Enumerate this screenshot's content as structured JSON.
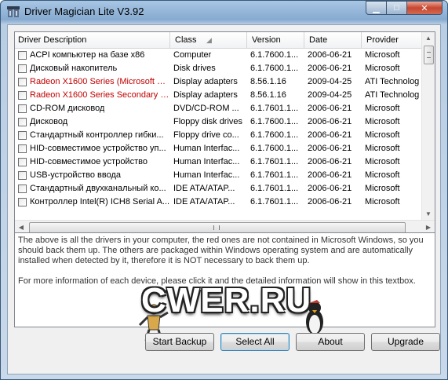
{
  "window": {
    "title": "Driver Magician Lite V3.92"
  },
  "caption_buttons": {
    "minimize": "▁",
    "maximize": "□",
    "close": "✕"
  },
  "columns": [
    "Driver Description",
    "Class",
    "Version",
    "Date",
    "Provider"
  ],
  "rows": [
    {
      "name": "ACPI компьютер на базе x86",
      "class": "Computer",
      "version": "6.1.7600.1...",
      "date": "2006-06-21",
      "provider": "Microsoft",
      "red": false
    },
    {
      "name": "Дисковый накопитель",
      "class": "Disk drives",
      "version": "6.1.7600.1...",
      "date": "2006-06-21",
      "provider": "Microsoft",
      "red": false
    },
    {
      "name": "Radeon X1600 Series (Microsoft C...",
      "class": "Display adapters",
      "version": "8.56.1.16",
      "date": "2009-04-25",
      "provider": "ATI Technolog",
      "red": true
    },
    {
      "name": "Radeon X1600 Series Secondary (...",
      "class": "Display adapters",
      "version": "8.56.1.16",
      "date": "2009-04-25",
      "provider": "ATI Technolog",
      "red": true
    },
    {
      "name": "CD-ROM дисковод",
      "class": "DVD/CD-ROM ...",
      "version": "6.1.7601.1...",
      "date": "2006-06-21",
      "provider": "Microsoft",
      "red": false
    },
    {
      "name": "Дисковод",
      "class": "Floppy disk drives",
      "version": "6.1.7600.1...",
      "date": "2006-06-21",
      "provider": "Microsoft",
      "red": false
    },
    {
      "name": "Стандартный контроллер гибки...",
      "class": "Floppy drive co...",
      "version": "6.1.7600.1...",
      "date": "2006-06-21",
      "provider": "Microsoft",
      "red": false
    },
    {
      "name": "HID-совместимое устройство уп...",
      "class": "Human Interfac...",
      "version": "6.1.7600.1...",
      "date": "2006-06-21",
      "provider": "Microsoft",
      "red": false
    },
    {
      "name": "HID-совместимое устройство",
      "class": "Human Interfac...",
      "version": "6.1.7601.1...",
      "date": "2006-06-21",
      "provider": "Microsoft",
      "red": false
    },
    {
      "name": "USB-устройство ввода",
      "class": "Human Interfac...",
      "version": "6.1.7601.1...",
      "date": "2006-06-21",
      "provider": "Microsoft",
      "red": false
    },
    {
      "name": "Стандартный двухканальный ко...",
      "class": "IDE ATA/ATAP...",
      "version": "6.1.7601.1...",
      "date": "2006-06-21",
      "provider": "Microsoft",
      "red": false
    },
    {
      "name": "Контроллер Intel(R) ICH8 Serial A...",
      "class": "IDE ATA/ATAP...",
      "version": "6.1.7601.1...",
      "date": "2006-06-21",
      "provider": "Microsoft",
      "red": false
    }
  ],
  "info": {
    "paragraph1": "The above is all the drivers in your computer, the red ones are not contained in Microsoft Windows, so you should back them up. The others are packaged within Windows operating system and are automatically installed when detected by it, therefore it is NOT necessary to back them up.",
    "paragraph2": "For more information of each device, please click it and the detailed information will show in this textbox."
  },
  "watermark": "CWER.RU",
  "buttons": {
    "start_backup": "Start Backup",
    "select_all": "Select All",
    "about": "About",
    "upgrade": "Upgrade"
  },
  "colors": {
    "red_driver": "#c00000",
    "title_bar": "#86aad0"
  }
}
